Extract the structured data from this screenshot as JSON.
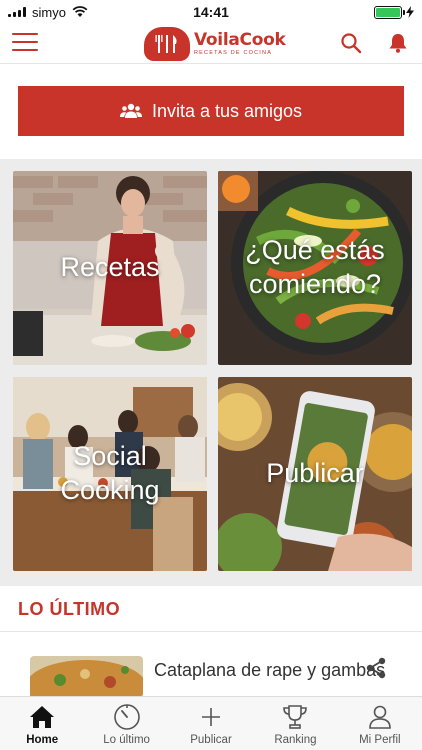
{
  "status_bar": {
    "carrier": "simyo",
    "time": "14:41",
    "battery_level": 1.0
  },
  "header": {
    "logo_name": "VoilaCook",
    "logo_subtitle": "RECETAS DE COCINA",
    "brand_color": "#c8332a"
  },
  "invite": {
    "label": "Invita a tus amigos",
    "icon": "users-icon"
  },
  "tiles": [
    {
      "label": "Recetas",
      "theme": "kitchen"
    },
    {
      "label": "¿Qué estás comiendo?",
      "theme": "pan-vegetables"
    },
    {
      "label": "Social Cooking",
      "theme": "dinner-party"
    },
    {
      "label": "Publicar",
      "theme": "phone-photo"
    }
  ],
  "latest": {
    "section_title": "LO ÚLTIMO",
    "items": [
      {
        "title": "Cataplana de rape y gambas"
      }
    ]
  },
  "bottom_nav": [
    {
      "label": "Home",
      "icon": "home-icon",
      "active": true
    },
    {
      "label": "Lo último",
      "icon": "timer-icon",
      "active": false
    },
    {
      "label": "Publicar",
      "icon": "plus-icon",
      "active": false
    },
    {
      "label": "Ranking",
      "icon": "trophy-icon",
      "active": false
    },
    {
      "label": "Mi Perfil",
      "icon": "user-icon",
      "active": false
    }
  ]
}
